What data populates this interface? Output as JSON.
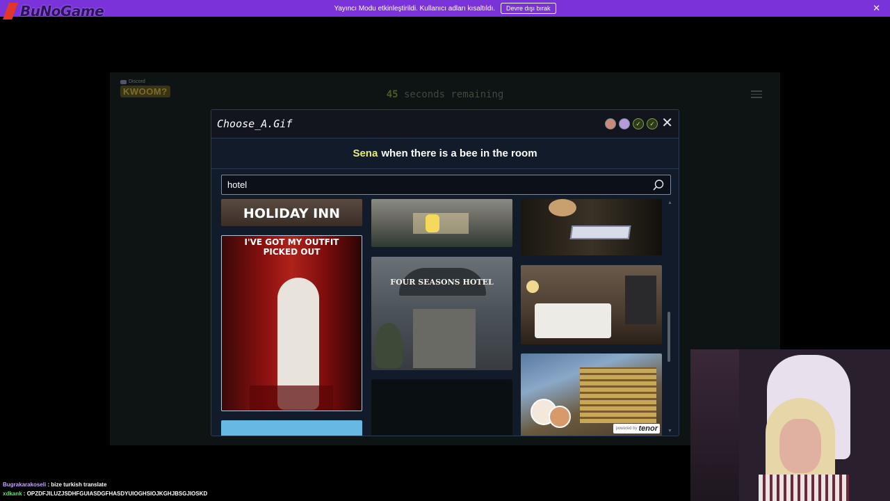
{
  "stream_banner": {
    "message": "Yayıncı Modu etkinleştirildi. Kullanıcı adları kısaltıldı.",
    "disable_button": "Devre dışı bırak",
    "close_icon": "close-icon",
    "logo_text": "BuNoGame"
  },
  "game": {
    "discord_label": "Discord",
    "logo_text": "KWOOM?",
    "timer_number": "45",
    "timer_text": "seconds remaining",
    "menu_icon": "hamburger-menu-icon"
  },
  "modal": {
    "title": "Choose_A.Gif",
    "players": [
      "avatar",
      "avatar",
      "done",
      "done"
    ],
    "close_icon": "close-icon",
    "prompt_name": "Sena",
    "prompt_text": "when there is a bee in the room",
    "search": {
      "value": "hotel",
      "icon": "search-icon"
    },
    "gifs": [
      {
        "caption": "HOLIDAY INN"
      },
      {
        "caption": "I'VE GOT MY OUTFIT PICKED OUT"
      },
      {
        "caption": ""
      },
      {
        "caption": ""
      },
      {
        "caption": ""
      },
      {
        "caption": ""
      },
      {
        "caption": ""
      },
      {
        "caption": ""
      },
      {
        "caption": ""
      }
    ],
    "powered_by": "powered by",
    "tenor": "tenor"
  },
  "chat": [
    {
      "user": "Bugrakarakoseli",
      "message": "bize turkish translate"
    },
    {
      "user": "xdkank",
      "message": "OPZDFJILUZJSDHFGUIASDGFHASDYUIOGHSIOJKGHJBSGJIOSKD"
    }
  ]
}
